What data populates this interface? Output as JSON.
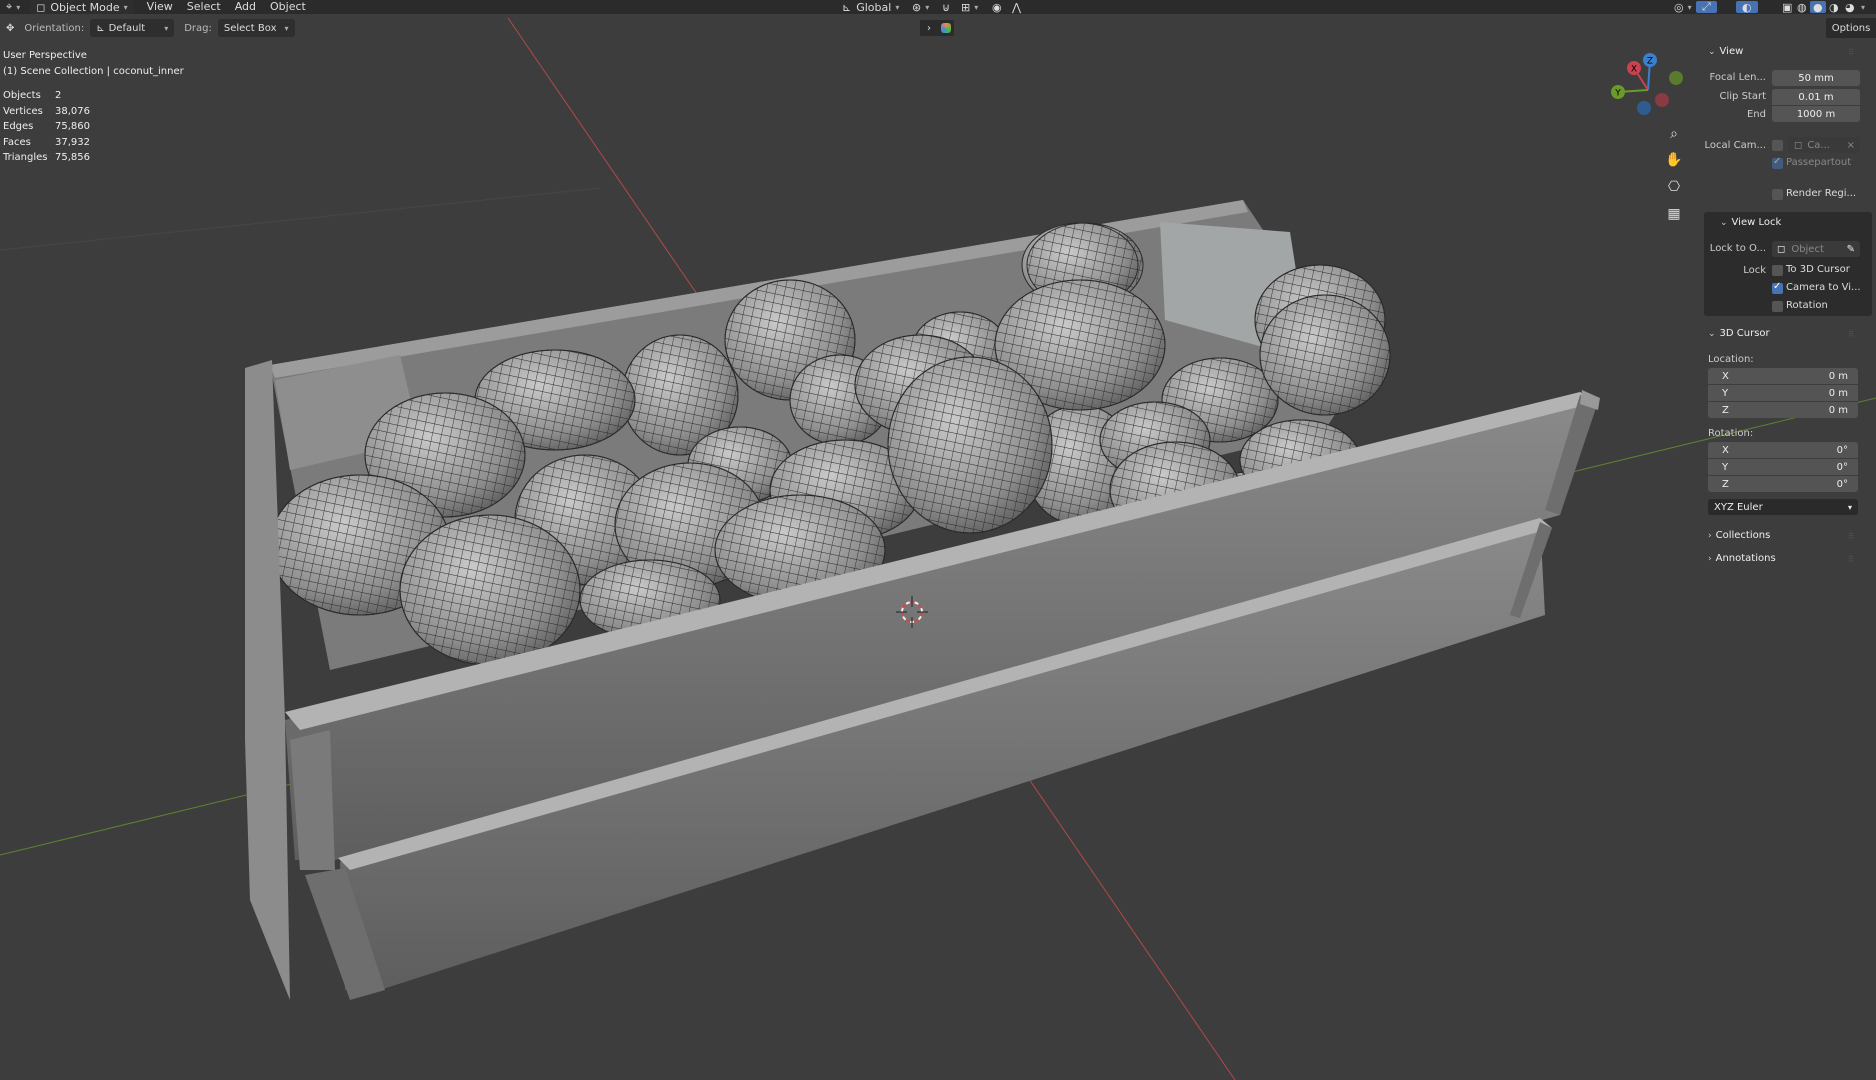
{
  "header": {
    "mode": "Object Mode",
    "menus": [
      "View",
      "Select",
      "Add",
      "Object"
    ],
    "transform_orientation": "Global"
  },
  "toolbar": {
    "orientation_label": "Orientation:",
    "orientation_value": "Default",
    "drag_label": "Drag:",
    "drag_value": "Select Box",
    "options_label": "Options"
  },
  "overlay": {
    "view_name": "User Perspective",
    "collection": "(1) Scene Collection | coconut_inner",
    "stats": [
      {
        "key": "Objects",
        "value": "2"
      },
      {
        "key": "Vertices",
        "value": "38,076"
      },
      {
        "key": "Edges",
        "value": "75,860"
      },
      {
        "key": "Faces",
        "value": "37,932"
      },
      {
        "key": "Triangles",
        "value": "75,856"
      }
    ]
  },
  "gizmo": {
    "x": "X",
    "y": "Y",
    "z": "Z"
  },
  "npanel": {
    "view": {
      "title": "View",
      "focal_label": "Focal Len...",
      "focal_value": "50 mm",
      "clip_start_label": "Clip Start",
      "clip_start_value": "0.01 m",
      "clip_end_label": "End",
      "clip_end_value": "1000 m",
      "local_cam_label": "Local Cam...",
      "local_cam_value": "Ca...",
      "passepartout": "Passepartout",
      "render_region": "Render Regi..."
    },
    "view_lock": {
      "title": "View Lock",
      "lock_to_label": "Lock to O...",
      "lock_to_value": "Object",
      "lock_label": "Lock",
      "to_3d_cursor": "To 3D Cursor",
      "camera_to_view": "Camera to Vi...",
      "rotation": "Rotation"
    },
    "cursor": {
      "title": "3D Cursor",
      "location_label": "Location:",
      "location": [
        {
          "axis": "X",
          "value": "0 m"
        },
        {
          "axis": "Y",
          "value": "0 m"
        },
        {
          "axis": "Z",
          "value": "0 m"
        }
      ],
      "rotation_label": "Rotation:",
      "rotation": [
        {
          "axis": "X",
          "value": "0°"
        },
        {
          "axis": "Y",
          "value": "0°"
        },
        {
          "axis": "Z",
          "value": "0°"
        }
      ],
      "rotation_mode": "XYZ Euler"
    },
    "collections": "Collections",
    "annotations": "Annotations"
  },
  "colors": {
    "x_axis": "#c9424f",
    "y_axis": "#6a9a2a",
    "z_axis": "#3b7fd0",
    "viewport_bg": "#3d3d3d",
    "accent": "#4772b3"
  }
}
